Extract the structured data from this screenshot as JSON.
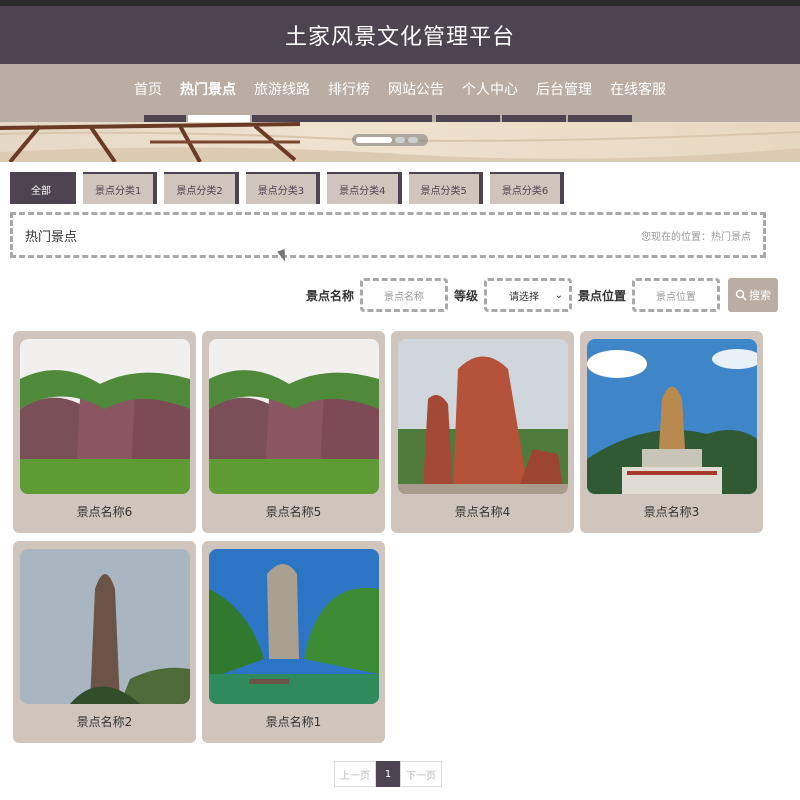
{
  "header": {
    "title": "土家风景文化管理平台"
  },
  "nav": {
    "items": [
      {
        "label": "首页",
        "active": false
      },
      {
        "label": "热门景点",
        "active": true
      },
      {
        "label": "旅游线路",
        "active": false
      },
      {
        "label": "排行榜",
        "active": false
      },
      {
        "label": "网站公告",
        "active": false
      },
      {
        "label": "个人中心",
        "active": false
      },
      {
        "label": "后台管理",
        "active": false
      },
      {
        "label": "在线客服",
        "active": false
      }
    ]
  },
  "tabs": [
    "全部",
    "景点分类1",
    "景点分类2",
    "景点分类3",
    "景点分类4",
    "景点分类5",
    "景点分类6"
  ],
  "breadcrumb": {
    "title": "热门景点",
    "location": "您现在的位置：热门景点"
  },
  "search": {
    "name_label": "景点名称",
    "name_placeholder": "景点名称",
    "level_label": "等级",
    "level_value": "请选择",
    "location_label": "景点位置",
    "location_placeholder": "景点位置",
    "button_label": "搜索"
  },
  "spots": [
    {
      "name": "景点名称6",
      "icon": "mountain-rocks-image"
    },
    {
      "name": "景点名称5",
      "icon": "mountain-rocks-image"
    },
    {
      "name": "景点名称4",
      "icon": "red-stone-image"
    },
    {
      "name": "景点名称3",
      "icon": "buddha-statue-image"
    },
    {
      "name": "景点名称2",
      "icon": "stone-pillar-image"
    },
    {
      "name": "景点名称1",
      "icon": "river-cliff-image"
    }
  ],
  "pager": {
    "prev": "上一页",
    "current": "1",
    "next": "下一页"
  },
  "colors": {
    "header": "#4e4350",
    "nav": "#b9ada4",
    "card": "#cfc5bc"
  }
}
